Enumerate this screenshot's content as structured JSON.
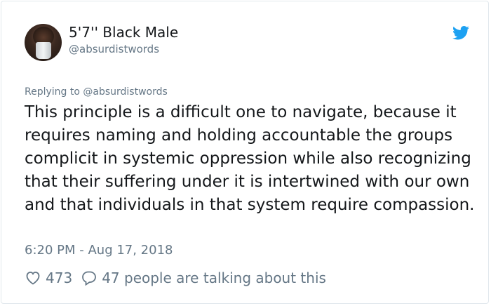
{
  "tweet": {
    "display_name": "5'7'' Black Male",
    "handle": "@absurdistwords",
    "replying_to": "Replying to @absurdistwords",
    "text": "This principle is a difficult one to navigate, because it requires naming and holding accountable the groups complicit in systemic oppression while also recognizing that their suffering under it is intertwined with our own and that individuals in that system require compassion.",
    "timestamp": "6:20 PM - Aug 17, 2018"
  },
  "actions": {
    "likes": "473",
    "replies_text": "47 people are talking about this"
  },
  "icons": {
    "brand": "twitter-bird-icon",
    "like": "heart-icon",
    "reply": "speech-bubble-icon"
  },
  "colors": {
    "brand_blue": "#1da1f2",
    "secondary_text": "#657786",
    "primary_text": "#14171a",
    "border": "#e1e8ed"
  }
}
